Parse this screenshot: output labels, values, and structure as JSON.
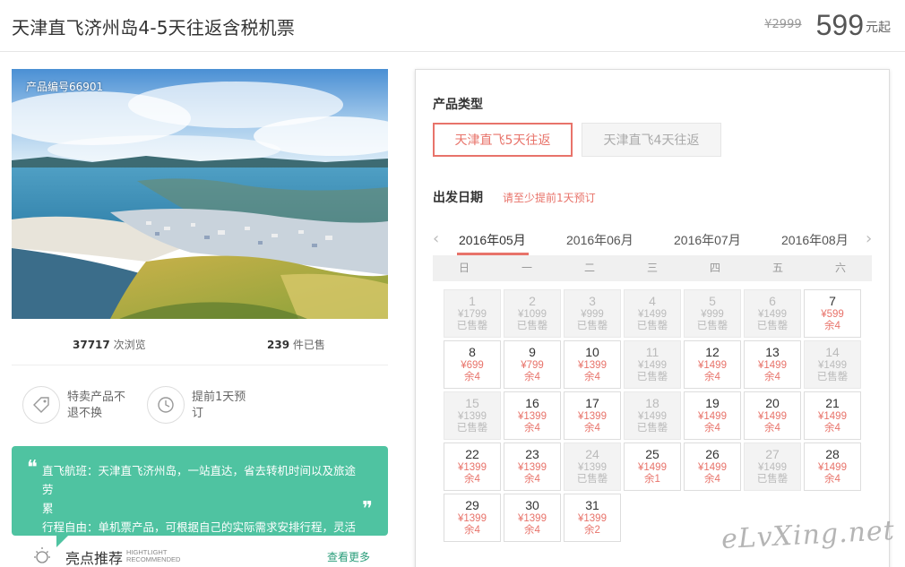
{
  "header": {
    "title": "天津直飞济州岛4-5天往返含税机票",
    "original_price": "¥2999",
    "price": "599",
    "price_unit": "元起"
  },
  "gallery": {
    "product_no": "产品编号66901"
  },
  "stats": {
    "views_count": "37717",
    "views_label": "次浏览",
    "sold_count": "239",
    "sold_label": "件已售"
  },
  "features": [
    {
      "icon": "tag-icon",
      "line1": "特卖产品不",
      "line2": "退不换"
    },
    {
      "icon": "clock-icon",
      "line1": "提前1天预",
      "line2": "订"
    }
  ],
  "notes": {
    "line1": "直飞航班：天津直飞济州岛，一站直达，省去转机时间以及旅途劳",
    "line2": "累",
    "line3": "行程自由：单机票产品，可根据自己的实际需求安排行程，灵活性"
  },
  "highlight": {
    "title": "亮点推荐",
    "sub1": "HIGHTLIGHT",
    "sub2": "RECOMMENDED",
    "more": "查看更多"
  },
  "booking": {
    "product_type_label": "产品类型",
    "product_types": [
      "天津直飞5天往返",
      "天津直飞4天往返"
    ],
    "depart_label": "出发日期",
    "depart_hint": "请至少提前1天预订",
    "months": [
      "2016年05月",
      "2016年06月",
      "2016年07月",
      "2016年08月"
    ],
    "weekdays": [
      "日",
      "一",
      "二",
      "三",
      "四",
      "五",
      "六"
    ]
  },
  "calendar": [
    {
      "day": "1",
      "price": "¥1799",
      "status": "已售罄",
      "sold": true
    },
    {
      "day": "2",
      "price": "¥1099",
      "status": "已售罄",
      "sold": true
    },
    {
      "day": "3",
      "price": "¥999",
      "status": "已售罄",
      "sold": true
    },
    {
      "day": "4",
      "price": "¥1499",
      "status": "已售罄",
      "sold": true
    },
    {
      "day": "5",
      "price": "¥999",
      "status": "已售罄",
      "sold": true
    },
    {
      "day": "6",
      "price": "¥1499",
      "status": "已售罄",
      "sold": true
    },
    {
      "day": "7",
      "price": "¥599",
      "status": "余4",
      "sold": false
    },
    {
      "day": "8",
      "price": "¥699",
      "status": "余4",
      "sold": false
    },
    {
      "day": "9",
      "price": "¥799",
      "status": "余4",
      "sold": false
    },
    {
      "day": "10",
      "price": "¥1399",
      "status": "余4",
      "sold": false
    },
    {
      "day": "11",
      "price": "¥1499",
      "status": "已售罄",
      "sold": true
    },
    {
      "day": "12",
      "price": "¥1499",
      "status": "余4",
      "sold": false
    },
    {
      "day": "13",
      "price": "¥1499",
      "status": "余4",
      "sold": false
    },
    {
      "day": "14",
      "price": "¥1499",
      "status": "已售罄",
      "sold": true
    },
    {
      "day": "15",
      "price": "¥1399",
      "status": "已售罄",
      "sold": true
    },
    {
      "day": "16",
      "price": "¥1399",
      "status": "余4",
      "sold": false
    },
    {
      "day": "17",
      "price": "¥1399",
      "status": "余4",
      "sold": false
    },
    {
      "day": "18",
      "price": "¥1499",
      "status": "已售罄",
      "sold": true
    },
    {
      "day": "19",
      "price": "¥1499",
      "status": "余4",
      "sold": false
    },
    {
      "day": "20",
      "price": "¥1499",
      "status": "余4",
      "sold": false
    },
    {
      "day": "21",
      "price": "¥1499",
      "status": "余4",
      "sold": false
    },
    {
      "day": "22",
      "price": "¥1399",
      "status": "余4",
      "sold": false
    },
    {
      "day": "23",
      "price": "¥1399",
      "status": "余4",
      "sold": false
    },
    {
      "day": "24",
      "price": "¥1399",
      "status": "已售罄",
      "sold": true
    },
    {
      "day": "25",
      "price": "¥1499",
      "status": "余1",
      "sold": false
    },
    {
      "day": "26",
      "price": "¥1499",
      "status": "余4",
      "sold": false
    },
    {
      "day": "27",
      "price": "¥1499",
      "status": "已售罄",
      "sold": true
    },
    {
      "day": "28",
      "price": "¥1499",
      "status": "余4",
      "sold": false
    },
    {
      "day": "29",
      "price": "¥1399",
      "status": "余4",
      "sold": false
    },
    {
      "day": "30",
      "price": "¥1399",
      "status": "余4",
      "sold": false
    },
    {
      "day": "31",
      "price": "¥1399",
      "status": "余2",
      "sold": false
    }
  ],
  "watermark": "eLvXing.net",
  "colors": {
    "accent": "#e8736a",
    "green": "#4fc3a1"
  }
}
